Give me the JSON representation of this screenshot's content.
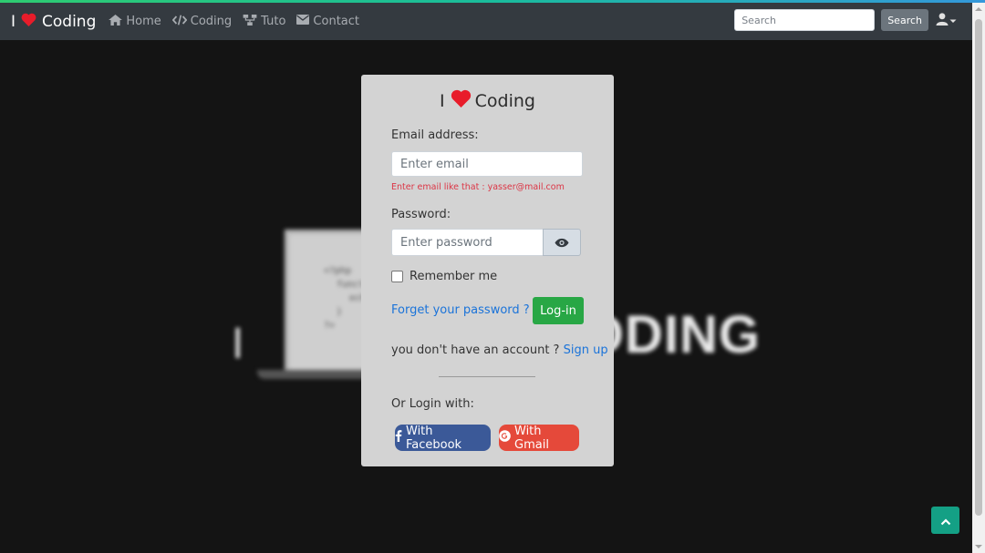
{
  "colors": {
    "navbar": "#343a40",
    "card": "#d3d3d3",
    "heart": "#e81c2a",
    "login_button": "#28a745",
    "facebook": "#3b5998",
    "gmail": "#e5493a",
    "link": "#1a73d9",
    "error": "#dc3545",
    "back_to_top": "#14a085"
  },
  "navbar": {
    "brand": {
      "prefix": "I",
      "icon": "heart-icon",
      "suffix": "Coding"
    },
    "links": [
      {
        "label": "Home",
        "icon": "home-icon"
      },
      {
        "label": "Coding",
        "icon": "code-icon"
      },
      {
        "label": "Tuto",
        "icon": "sitemap-icon"
      },
      {
        "label": "Contact",
        "icon": "envelope-icon"
      }
    ],
    "search_placeholder": "Search",
    "search_button": "Search",
    "user_icon": "user-icon"
  },
  "hero": {
    "letter": "I",
    "word": "CODING",
    "code_lines": [
      "<?php",
      "function",
      "echo",
      "}",
      "?>"
    ]
  },
  "login": {
    "title": {
      "prefix": "I",
      "icon": "heart-icon",
      "suffix": "Coding"
    },
    "email_label": "Email address:",
    "email_placeholder": "Enter email",
    "email_hint": "Enter email like that : yasser@mail.com",
    "password_label": "Password:",
    "password_placeholder": "Enter password",
    "show_password_icon": "eye-icon",
    "remember_label": "Remember me",
    "remember_checked": false,
    "forgot_link": "Forget your password ?",
    "login_button": "Log-in",
    "no_account_text": "you don't have an account ?",
    "signup_link": "Sign up",
    "or_login_text": "Or Login with:",
    "facebook_button": "With Facebook",
    "gmail_button": "With Gmail"
  },
  "back_to_top_icon": "chevron-up-icon"
}
